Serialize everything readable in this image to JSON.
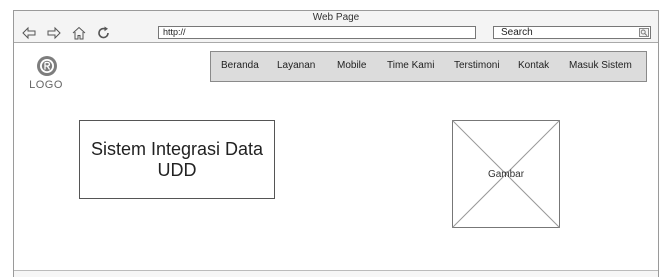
{
  "window": {
    "title": "Web Page"
  },
  "toolbar": {
    "url_value": "http://",
    "search_label": "Search"
  },
  "logo": {
    "text": "LOGO"
  },
  "nav": {
    "items": [
      "Beranda",
      "Layanan",
      "Mobile",
      "Time Kami",
      "Terstimoni",
      "Kontak",
      "Masuk Sistem"
    ]
  },
  "hero": {
    "title": "Sistem Integrasi Data UDD"
  },
  "image": {
    "label": "Gambar"
  }
}
